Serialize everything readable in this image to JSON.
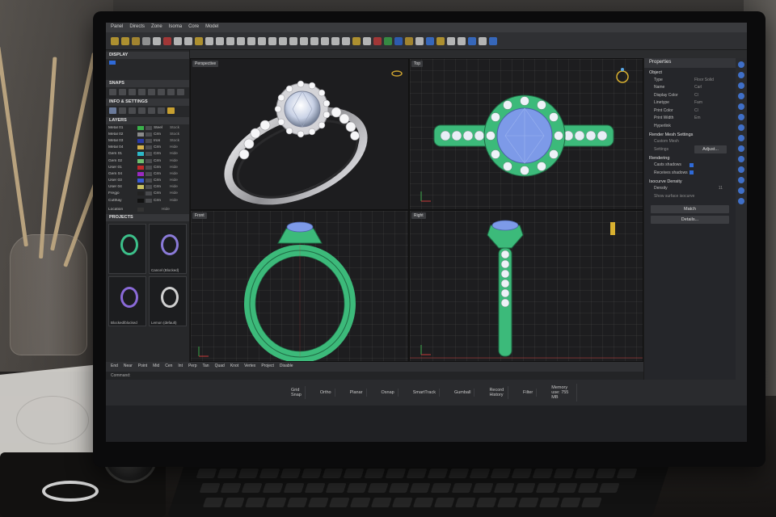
{
  "menu": [
    "Panel",
    "Directs",
    "Zone",
    "Isoma",
    "Core",
    "Model"
  ],
  "left_panel": {
    "display_title": "DISPLAY",
    "snaps_title": "SNAPS",
    "info_title": "INFO & SETTINGS",
    "layers_title": "LAYERS",
    "layers": [
      {
        "name": "Metal 01",
        "mat": "Steel",
        "stat": "Stock",
        "color": "#3ab04a"
      },
      {
        "name": "Metal 02",
        "mat": "Crm",
        "stat": "Stock",
        "color": "#8a8a8a"
      },
      {
        "name": "Metal 03",
        "mat": "Iron",
        "stat": "Stock",
        "color": "#2a3aa8"
      },
      {
        "name": "Metal 04",
        "mat": "Crm",
        "stat": "Hide",
        "color": "#d3b04a"
      },
      {
        "name": "Gem 01",
        "mat": "Crm",
        "stat": "Hide",
        "color": "#2db8c8"
      },
      {
        "name": "Gem 02",
        "mat": "Crm",
        "stat": "Hide",
        "color": "#6ec070"
      },
      {
        "name": "User 01",
        "mat": "Crm",
        "stat": "Hide",
        "color": "#c02a2a"
      },
      {
        "name": "Gem 04",
        "mat": "Crm",
        "stat": "Hide",
        "color": "#9a2ac0"
      },
      {
        "name": "User 03",
        "mat": "Crm",
        "stat": "Hide",
        "color": "#3a5ad8"
      },
      {
        "name": "User 04",
        "mat": "Crm",
        "stat": "Hide",
        "color": "#c8c060"
      },
      {
        "name": "Fregjo",
        "mat": "Crm",
        "stat": "Hide",
        "color": "#222222"
      },
      {
        "name": "Cutthay",
        "mat": "Crm",
        "stat": "Hide",
        "color": "#111111"
      }
    ],
    "location_label": "Location",
    "location_status": "Hide",
    "projects_title": "PROJECTS",
    "projects": [
      {
        "label": "",
        "color": "#3cc08a"
      },
      {
        "label": "Cancel (Blocked)",
        "color": "#8a7ad8"
      },
      {
        "label": "Blocked/blocked",
        "color": "#8a6ad8"
      },
      {
        "label": "Lemon (default)",
        "color": "#d0d0d0"
      }
    ]
  },
  "viewports": {
    "perspective": "Perspective",
    "top": "Top",
    "front": "Front",
    "right": "Right"
  },
  "properties": {
    "title": "Properties",
    "object_section": "Object",
    "rows": [
      {
        "k": "Type",
        "v": "Floor Solid"
      },
      {
        "k": "Name",
        "v": "Carl"
      },
      {
        "k": "Display Color",
        "v": "Cl"
      },
      {
        "k": "Linetype",
        "v": "Fam"
      },
      {
        "k": "Print Color",
        "v": "Cl"
      },
      {
        "k": "Print Width",
        "v": "Em"
      },
      {
        "k": "Hyperlink",
        "v": ""
      }
    ],
    "render_mesh_section": "Render Mesh Settings",
    "custom_mesh": "Custom Mesh",
    "settings_label": "Settings",
    "adjust_button": "Adjust...",
    "rendering_section": "Rendering",
    "casts_shadows": "Casts shadows",
    "receives_shadows": "Receives shadows",
    "isocurve_section": "Isocurve Density",
    "density_label": "Density",
    "density_value": "11",
    "show_surface": "Show surface isocurve",
    "match_button": "Match",
    "details_button": "Details..."
  },
  "osnaps": [
    "End",
    "Near",
    "Point",
    "Mid",
    "Cen",
    "Int",
    "Perp",
    "Tan",
    "Quad",
    "Knot",
    "Vertex",
    "Project",
    "Disable"
  ],
  "command_label": "Command:",
  "status": [
    "Grid Snap",
    "Ortho",
    "Planar",
    "Osnap",
    "SmartTrack",
    "Gumball",
    "Record History",
    "Filter",
    "Memory use: 755 MB"
  ],
  "colors": {
    "green_model": "#3cba7a",
    "gem_blue": "#7d9ae8",
    "silver": "#d8d8dc",
    "accent": "#2f6ad8"
  }
}
